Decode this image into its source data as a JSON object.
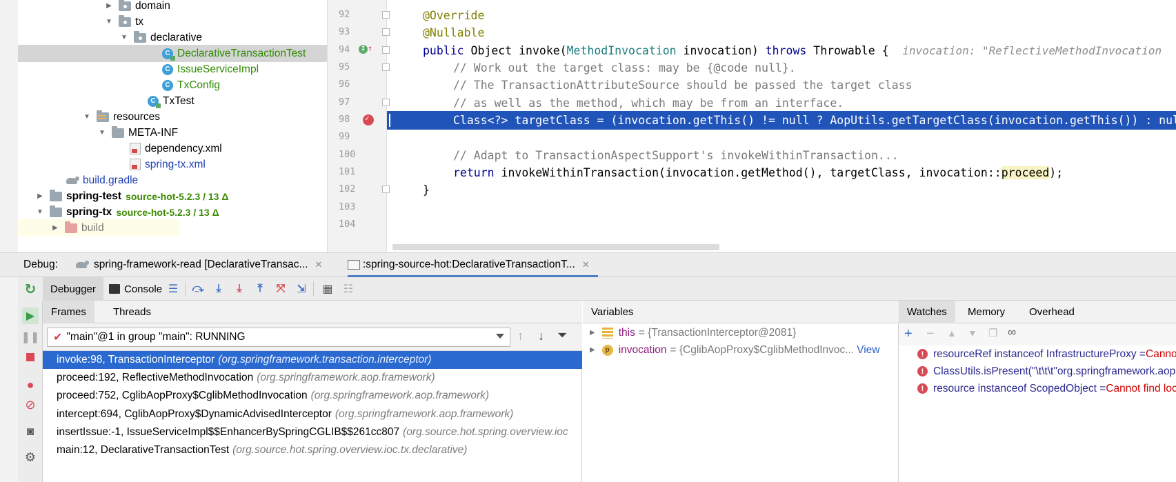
{
  "tree": {
    "rows": [
      {
        "label": "domain",
        "kind": "package"
      },
      {
        "label": "tx",
        "kind": "package"
      },
      {
        "label": "declarative",
        "kind": "package"
      },
      {
        "label": "DeclarativeTransactionTest",
        "kind": "test-class"
      },
      {
        "label": "IssueServiceImpl",
        "kind": "class"
      },
      {
        "label": "TxConfig",
        "kind": "class"
      },
      {
        "label": "TxTest",
        "kind": "test-class"
      },
      {
        "label": "resources",
        "kind": "resources-folder"
      },
      {
        "label": "META-INF",
        "kind": "folder"
      },
      {
        "label": "dependency.xml",
        "kind": "xml"
      },
      {
        "label": "spring-tx.xml",
        "kind": "xml"
      },
      {
        "label": "build.gradle",
        "kind": "gradle"
      },
      {
        "label": "spring-test",
        "kind": "module",
        "vcs": "source-hot-5.2.3 / 13 Δ"
      },
      {
        "label": "spring-tx",
        "kind": "module",
        "vcs": "source-hot-5.2.3 / 13 Δ"
      },
      {
        "label": "build",
        "kind": "excluded-folder"
      }
    ]
  },
  "editor": {
    "line_numbers": [
      "92",
      "93",
      "94",
      "95",
      "96",
      "97",
      "98",
      "99",
      "100",
      "101",
      "102",
      "103",
      "104"
    ],
    "lines": {
      "l92": "@Override",
      "l93": "@Nullable",
      "l94_kw1": "public",
      "l94_a": " Object invoke(",
      "l94_type": "MethodInvocation",
      "l94_b": " invocation) ",
      "l94_kw2": "throws",
      "l94_c": " Throwable {  ",
      "l94_hint": "invocation: \"ReflectiveMethodInvocation",
      "l95": "// Work out the target class: may be {@code null}.",
      "l96": "// The TransactionAttributeSource should be passed the target class",
      "l97": "// as well as the method, which may be from an interface.",
      "l98": "Class<?> targetClass = (invocation.getThis() != null ? AopUtils.getTargetClass(invocation.getThis()) : null);",
      "l100": "// Adapt to TransactionAspectSupport's invokeWithinTransaction...",
      "l101_kw": "return",
      "l101_a": " invokeWithinTransaction(invocation.getMethod(), targetClass, invocation::",
      "l101_hl": "proceed",
      "l101_b": ");",
      "l102": "}"
    }
  },
  "debug": {
    "label": "Debug:",
    "tabs": [
      {
        "label": "spring-framework-read [DeclarativeTransac..."
      },
      {
        "label": ":spring-source-hot:DeclarativeTransactionT..."
      }
    ],
    "subtabs": {
      "debugger": "Debugger",
      "console": "Console"
    },
    "frames_tabs": {
      "frames": "Frames",
      "threads": "Threads"
    },
    "thread_selector": "\"main\"@1 in group \"main\": RUNNING",
    "frames": [
      {
        "method": "invoke:98, TransactionInterceptor",
        "pkg": "(org.springframework.transaction.interceptor)"
      },
      {
        "method": "proceed:192, ReflectiveMethodInvocation",
        "pkg": "(org.springframework.aop.framework)"
      },
      {
        "method": "proceed:752, CglibAopProxy$CglibMethodInvocation",
        "pkg": "(org.springframework.aop.framework)"
      },
      {
        "method": "intercept:694, CglibAopProxy$DynamicAdvisedInterceptor",
        "pkg": "(org.springframework.aop.framework)"
      },
      {
        "method": "insertIssue:-1, IssueServiceImpl$$EnhancerBySpringCGLIB$$261cc807",
        "pkg": "(org.source.hot.spring.overview.ioc"
      },
      {
        "method": "main:12, DeclarativeTransactionTest",
        "pkg": "(org.source.hot.spring.overview.ioc.tx.declarative)"
      }
    ],
    "variables_title": "Variables",
    "variables": [
      {
        "name": "this",
        "value": "= {TransactionInterceptor@2081}",
        "icon": "field",
        "link": ""
      },
      {
        "name": "invocation",
        "value": "= {CglibAopProxy$CglibMethodInvoc...",
        "icon": "param",
        "link": "View"
      }
    ],
    "watch_tabs": {
      "watches": "Watches",
      "memory": "Memory",
      "overhead": "Overhead"
    },
    "watches": [
      {
        "expr": "resourceRef instanceof InfrastructureProxy = ",
        "error": "Cannot find local variable"
      },
      {
        "expr": "ClassUtils.isPresent(\"\\t\\t\\t\"org.springframework.aop.scope",
        "error": ""
      },
      {
        "expr": "resource instanceof ScopedObject = ",
        "error": "Cannot find local variable"
      }
    ]
  }
}
